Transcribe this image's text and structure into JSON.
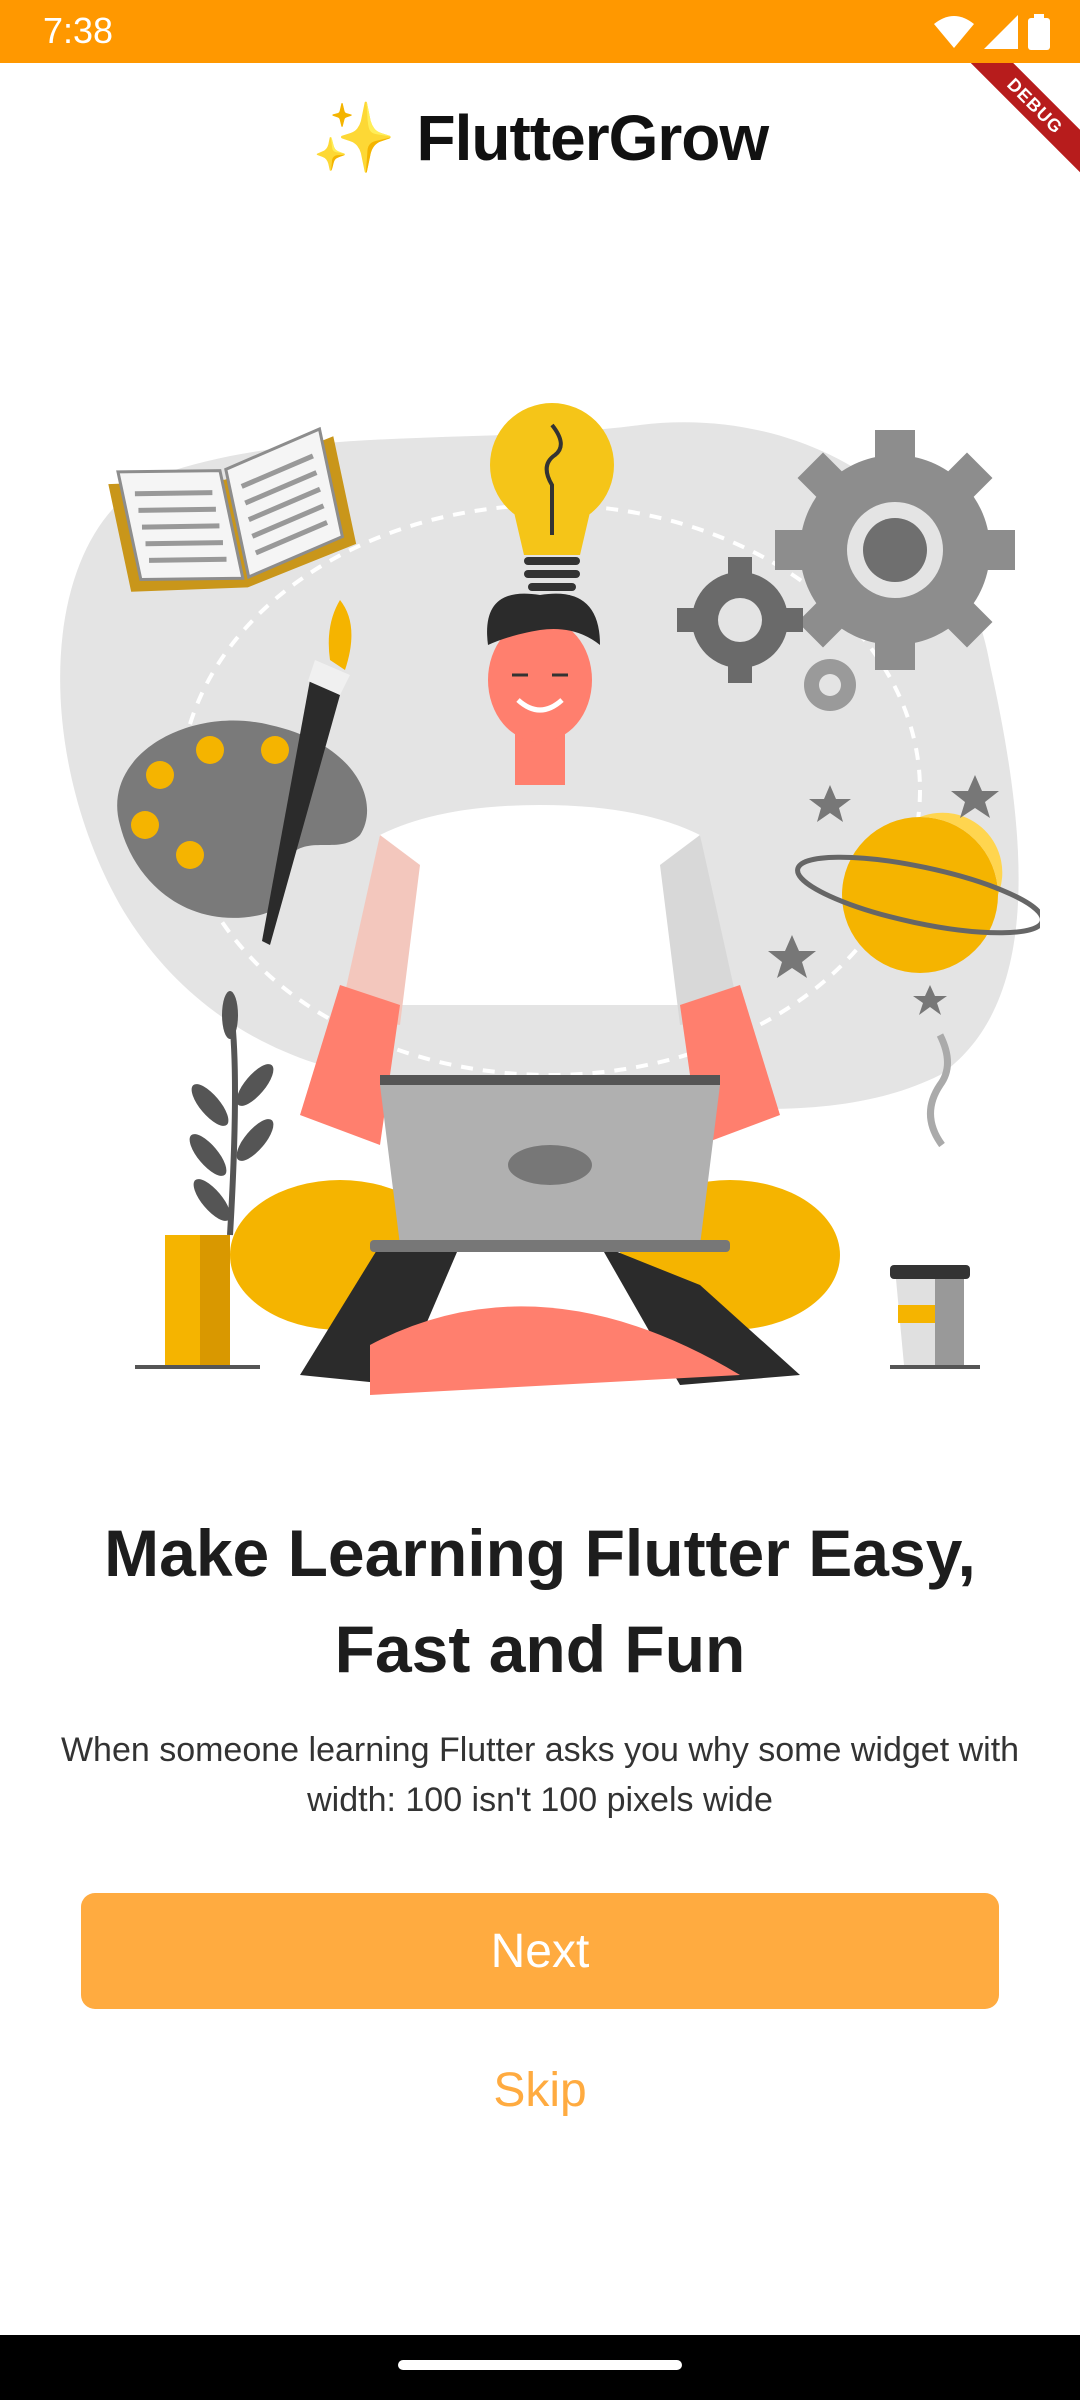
{
  "status_bar": {
    "time": "7:38",
    "background": "#FF9800",
    "icons": [
      "wifi-icon",
      "signal-icon",
      "battery-icon"
    ]
  },
  "debug_banner": {
    "label": "DEBUG",
    "color": "#B71C1C"
  },
  "header": {
    "sparkle": "✨",
    "title": "FlutterGrow"
  },
  "illustration": {
    "icons": [
      "book-icon",
      "lightbulb-icon",
      "gear-icon",
      "palette-icon",
      "planet-icon",
      "plant-icon",
      "coffee-cup-icon",
      "person-with-laptop"
    ]
  },
  "onboarding": {
    "title": "Make Learning Flutter Easy, Fast and Fun",
    "description": "When someone learning Flutter asks you why some widget with width: 100 isn't 100 pixels wide"
  },
  "actions": {
    "next_label": "Next",
    "skip_label": "Skip",
    "accent": "#FFAB40"
  }
}
